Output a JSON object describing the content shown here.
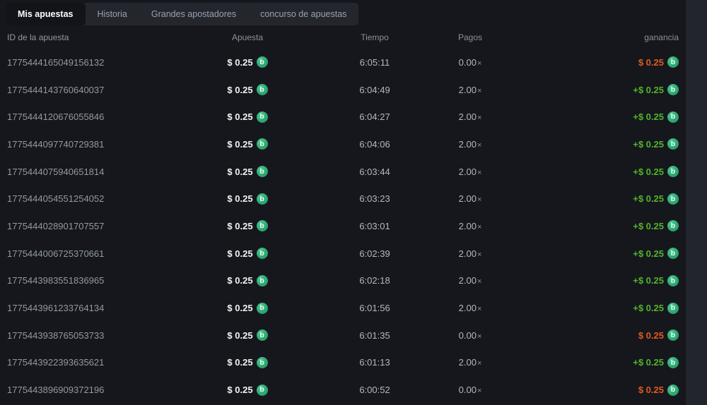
{
  "tabs": [
    {
      "label": "Mis apuestas",
      "active": true
    },
    {
      "label": "Historia",
      "active": false
    },
    {
      "label": "Grandes apostadores",
      "active": false
    },
    {
      "label": "concurso de apuestas",
      "active": false
    }
  ],
  "table": {
    "columns": [
      "ID de la apuesta",
      "Apuesta",
      "Tiempo",
      "Pagos",
      "ganancia"
    ],
    "multiplier_symbol": "×",
    "rows": [
      {
        "id": "1775444165049156132",
        "bet": "$ 0.25",
        "time": "6:05:11",
        "payout": "0.00",
        "profit": "$ 0.25",
        "win": false
      },
      {
        "id": "1775444143760640037",
        "bet": "$ 0.25",
        "time": "6:04:49",
        "payout": "2.00",
        "profit": "+$ 0.25",
        "win": true
      },
      {
        "id": "1775444120676055846",
        "bet": "$ 0.25",
        "time": "6:04:27",
        "payout": "2.00",
        "profit": "+$ 0.25",
        "win": true
      },
      {
        "id": "1775444097740729381",
        "bet": "$ 0.25",
        "time": "6:04:06",
        "payout": "2.00",
        "profit": "+$ 0.25",
        "win": true
      },
      {
        "id": "1775444075940651814",
        "bet": "$ 0.25",
        "time": "6:03:44",
        "payout": "2.00",
        "profit": "+$ 0.25",
        "win": true
      },
      {
        "id": "1775444054551254052",
        "bet": "$ 0.25",
        "time": "6:03:23",
        "payout": "2.00",
        "profit": "+$ 0.25",
        "win": true
      },
      {
        "id": "1775444028901707557",
        "bet": "$ 0.25",
        "time": "6:03:01",
        "payout": "2.00",
        "profit": "+$ 0.25",
        "win": true
      },
      {
        "id": "1775444006725370661",
        "bet": "$ 0.25",
        "time": "6:02:39",
        "payout": "2.00",
        "profit": "+$ 0.25",
        "win": true
      },
      {
        "id": "1775443983551836965",
        "bet": "$ 0.25",
        "time": "6:02:18",
        "payout": "2.00",
        "profit": "+$ 0.25",
        "win": true
      },
      {
        "id": "1775443961233764134",
        "bet": "$ 0.25",
        "time": "6:01:56",
        "payout": "2.00",
        "profit": "+$ 0.25",
        "win": true
      },
      {
        "id": "1775443938765053733",
        "bet": "$ 0.25",
        "time": "6:01:35",
        "payout": "0.00",
        "profit": "$ 0.25",
        "win": false
      },
      {
        "id": "1775443922393635621",
        "bet": "$ 0.25",
        "time": "6:01:13",
        "payout": "2.00",
        "profit": "+$ 0.25",
        "win": true
      },
      {
        "id": "1775443896909372196",
        "bet": "$ 0.25",
        "time": "6:00:52",
        "payout": "0.00",
        "profit": "$ 0.25",
        "win": false
      }
    ]
  },
  "icons": {
    "coin": "bcd-coin-icon",
    "coin_glyph": "b"
  },
  "colors": {
    "win_green": "#54b32e",
    "loss_orange": "#e05a20",
    "coin_green": "#2fa874",
    "panel_bg": "#15171c",
    "tabbar_bg": "#23262d",
    "active_tab_bg": "#121419"
  }
}
